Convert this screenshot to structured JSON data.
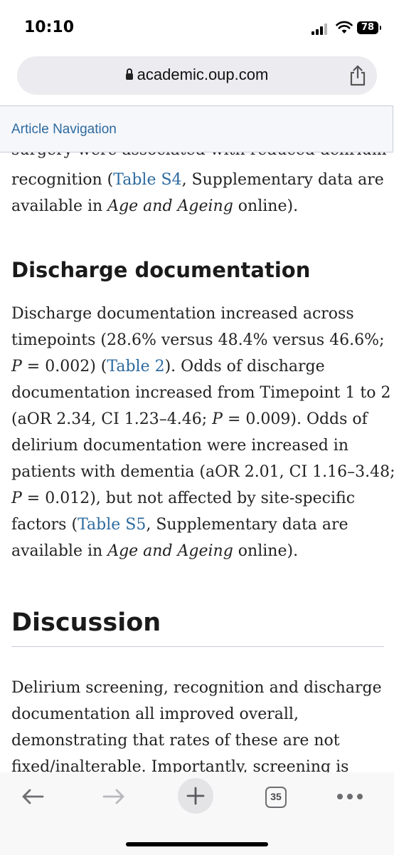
{
  "status_bar": {
    "time": "10:10",
    "battery": "78",
    "icons": [
      "signal-icon",
      "wifi-icon",
      "battery-icon"
    ]
  },
  "url_bar": {
    "domain": "academic.oup.com",
    "icons": [
      "lock-icon",
      "share-icon"
    ]
  },
  "article_nav": {
    "label": "Article Navigation"
  },
  "content": {
    "cut_line": "surgery were associated with reduced delirium",
    "p1": {
      "t1": "recognition (",
      "link1": "Table S4",
      "t2": ", Supplementary data are",
      "t3": "available in ",
      "em1": "Age and Ageing",
      "t4": " online)."
    },
    "heading_discharge": "Discharge documentation",
    "p2": {
      "l1": "Discharge documentation increased across",
      "l2": "timepoints (28.6% versus 48.4% versus 46.6%;",
      "l3_p": "P",
      "l3_a": " = 0.002) (",
      "l3_link": "Table 2",
      "l3_b": "). Odds of discharge",
      "l4": "documentation increased from Timepoint 1 to 2",
      "l5_a": "(aOR 2.34, CI 1.23–4.46; ",
      "l5_p": "P",
      "l5_b": " = 0.009). Odds of",
      "l6": "delirium documentation were increased in",
      "l7": "patients with dementia (aOR 2.01, CI 1.16–3.48;",
      "l8_p": "P",
      "l8_a": " = 0.012), but not affected by site-specific",
      "l9_a": "factors (",
      "l9_link": "Table S5",
      "l9_b": ", Supplementary data are",
      "l10_a": "available in ",
      "l10_em": "Age and Ageing",
      "l10_b": " online)."
    },
    "heading_discussion": "Discussion",
    "p3": {
      "l1": "Delirium screening, recognition and discharge",
      "l2": "documentation all improved overall,",
      "l3": "demonstrating that rates of these are not",
      "l4": "fixed/inalterable. Importantly, screening is"
    }
  },
  "toolbar": {
    "tabs_count": "35",
    "icons": [
      "back-arrow-icon",
      "forward-arrow-icon",
      "plus-icon",
      "tabs-icon",
      "more-icon"
    ]
  },
  "colors": {
    "link": "#2d6a9f",
    "text": "#222222",
    "nav_bg": "#f6f7fb",
    "url_bar_bg": "#ececf0"
  }
}
